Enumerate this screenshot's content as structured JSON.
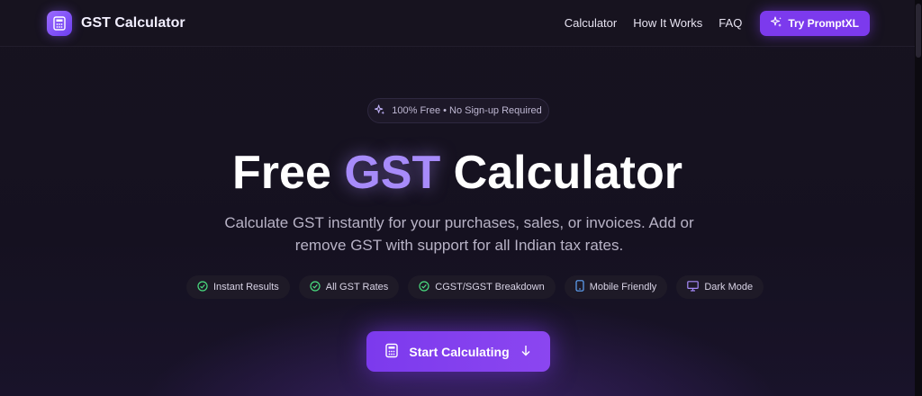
{
  "brand": {
    "name": "GST Calculator",
    "icon": "calculator-icon"
  },
  "nav": {
    "links": [
      "Calculator",
      "How It Works",
      "FAQ"
    ],
    "cta_label": "Try PromptXL",
    "cta_icon": "sparkles-icon"
  },
  "hero": {
    "badge": "100% Free • No Sign-up Required",
    "title_before": "Free ",
    "title_accent": "GST",
    "title_after": " Calculator",
    "subtitle": "Calculate GST instantly for your purchases, sales, or invoices. Add or remove GST with support for all Indian tax rates.",
    "features": [
      {
        "label": "Instant Results",
        "icon": "check-circle-icon"
      },
      {
        "label": "All GST Rates",
        "icon": "check-circle-icon"
      },
      {
        "label": "CGST/SGST Breakdown",
        "icon": "check-circle-icon"
      },
      {
        "label": "Mobile Friendly",
        "icon": "smartphone-icon"
      },
      {
        "label": "Dark Mode",
        "icon": "monitor-icon"
      }
    ],
    "cta_label": "Start Calculating",
    "cta_icon": "calculator-icon",
    "cta_arrow_icon": "arrow-down-icon"
  },
  "colors": {
    "background": "#16121f",
    "accent": "#7c3aed",
    "accent_text": "#a78bfa",
    "check_green": "#4ade80",
    "device_blue": "#60a5fa",
    "monitor_purple": "#a78bfa"
  }
}
